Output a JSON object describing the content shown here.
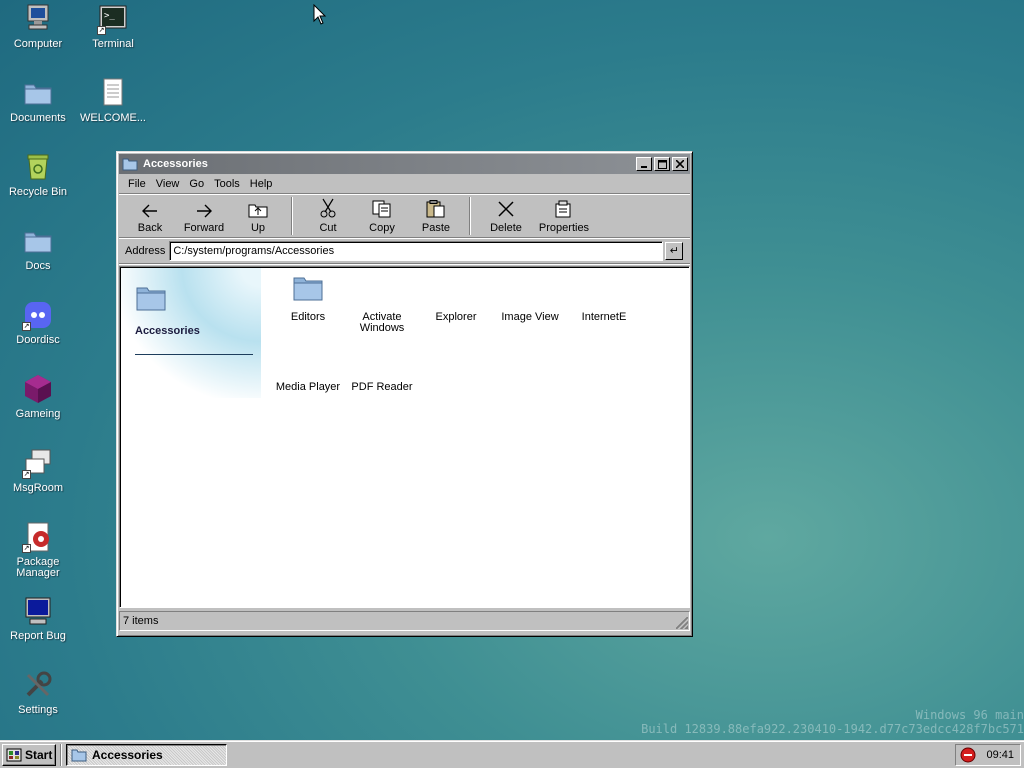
{
  "desktop": {
    "icons": [
      {
        "label": "Computer",
        "icon": "computer-icon"
      },
      {
        "label": "Terminal",
        "icon": "terminal-icon"
      },
      {
        "label": "Documents",
        "icon": "folder-icon"
      },
      {
        "label": "WELCOME...",
        "icon": "document-icon"
      },
      {
        "label": "Recycle Bin",
        "icon": "recycle-bin-icon"
      },
      {
        "label": "Docs",
        "icon": "folder-icon"
      },
      {
        "label": "Doordisc",
        "icon": "discord-icon"
      },
      {
        "label": "Gameing",
        "icon": "game-cube-icon"
      },
      {
        "label": "MsgRoom",
        "icon": "chat-icon"
      },
      {
        "label": "Package Manager",
        "icon": "package-icon"
      },
      {
        "label": "Report Bug",
        "icon": "bug-report-icon"
      },
      {
        "label": "Settings",
        "icon": "settings-icon"
      }
    ]
  },
  "window": {
    "title": "Accessories",
    "menu": [
      "File",
      "View",
      "Go",
      "Tools",
      "Help"
    ],
    "toolbar": {
      "back": "Back",
      "forward": "Forward",
      "up": "Up",
      "cut": "Cut",
      "copy": "Copy",
      "paste": "Paste",
      "delete": "Delete",
      "properties": "Properties"
    },
    "address": {
      "label": "Address",
      "value": "C:/system/programs/Accessories",
      "go": "↵"
    },
    "side_panel": {
      "title": "Accessories"
    },
    "items": [
      "Editors",
      "Activate Windows",
      "Explorer",
      "Image View",
      "InternetE",
      "Media Player",
      "PDF Reader"
    ],
    "status": "7 items"
  },
  "watermark": {
    "line1": "Windows 96 main",
    "line2": "Build 12839.88efa922.230410-1942.d77c73edcc428f7bc571"
  },
  "taskbar": {
    "start_label": "Start",
    "active_task": "Accessories",
    "clock": "09:41"
  },
  "colors": {
    "desktop": "#2c7c8c",
    "window_chrome": "#c0c0c0",
    "titlebar": "#6b6f74",
    "folder": "#8fb3d9"
  }
}
